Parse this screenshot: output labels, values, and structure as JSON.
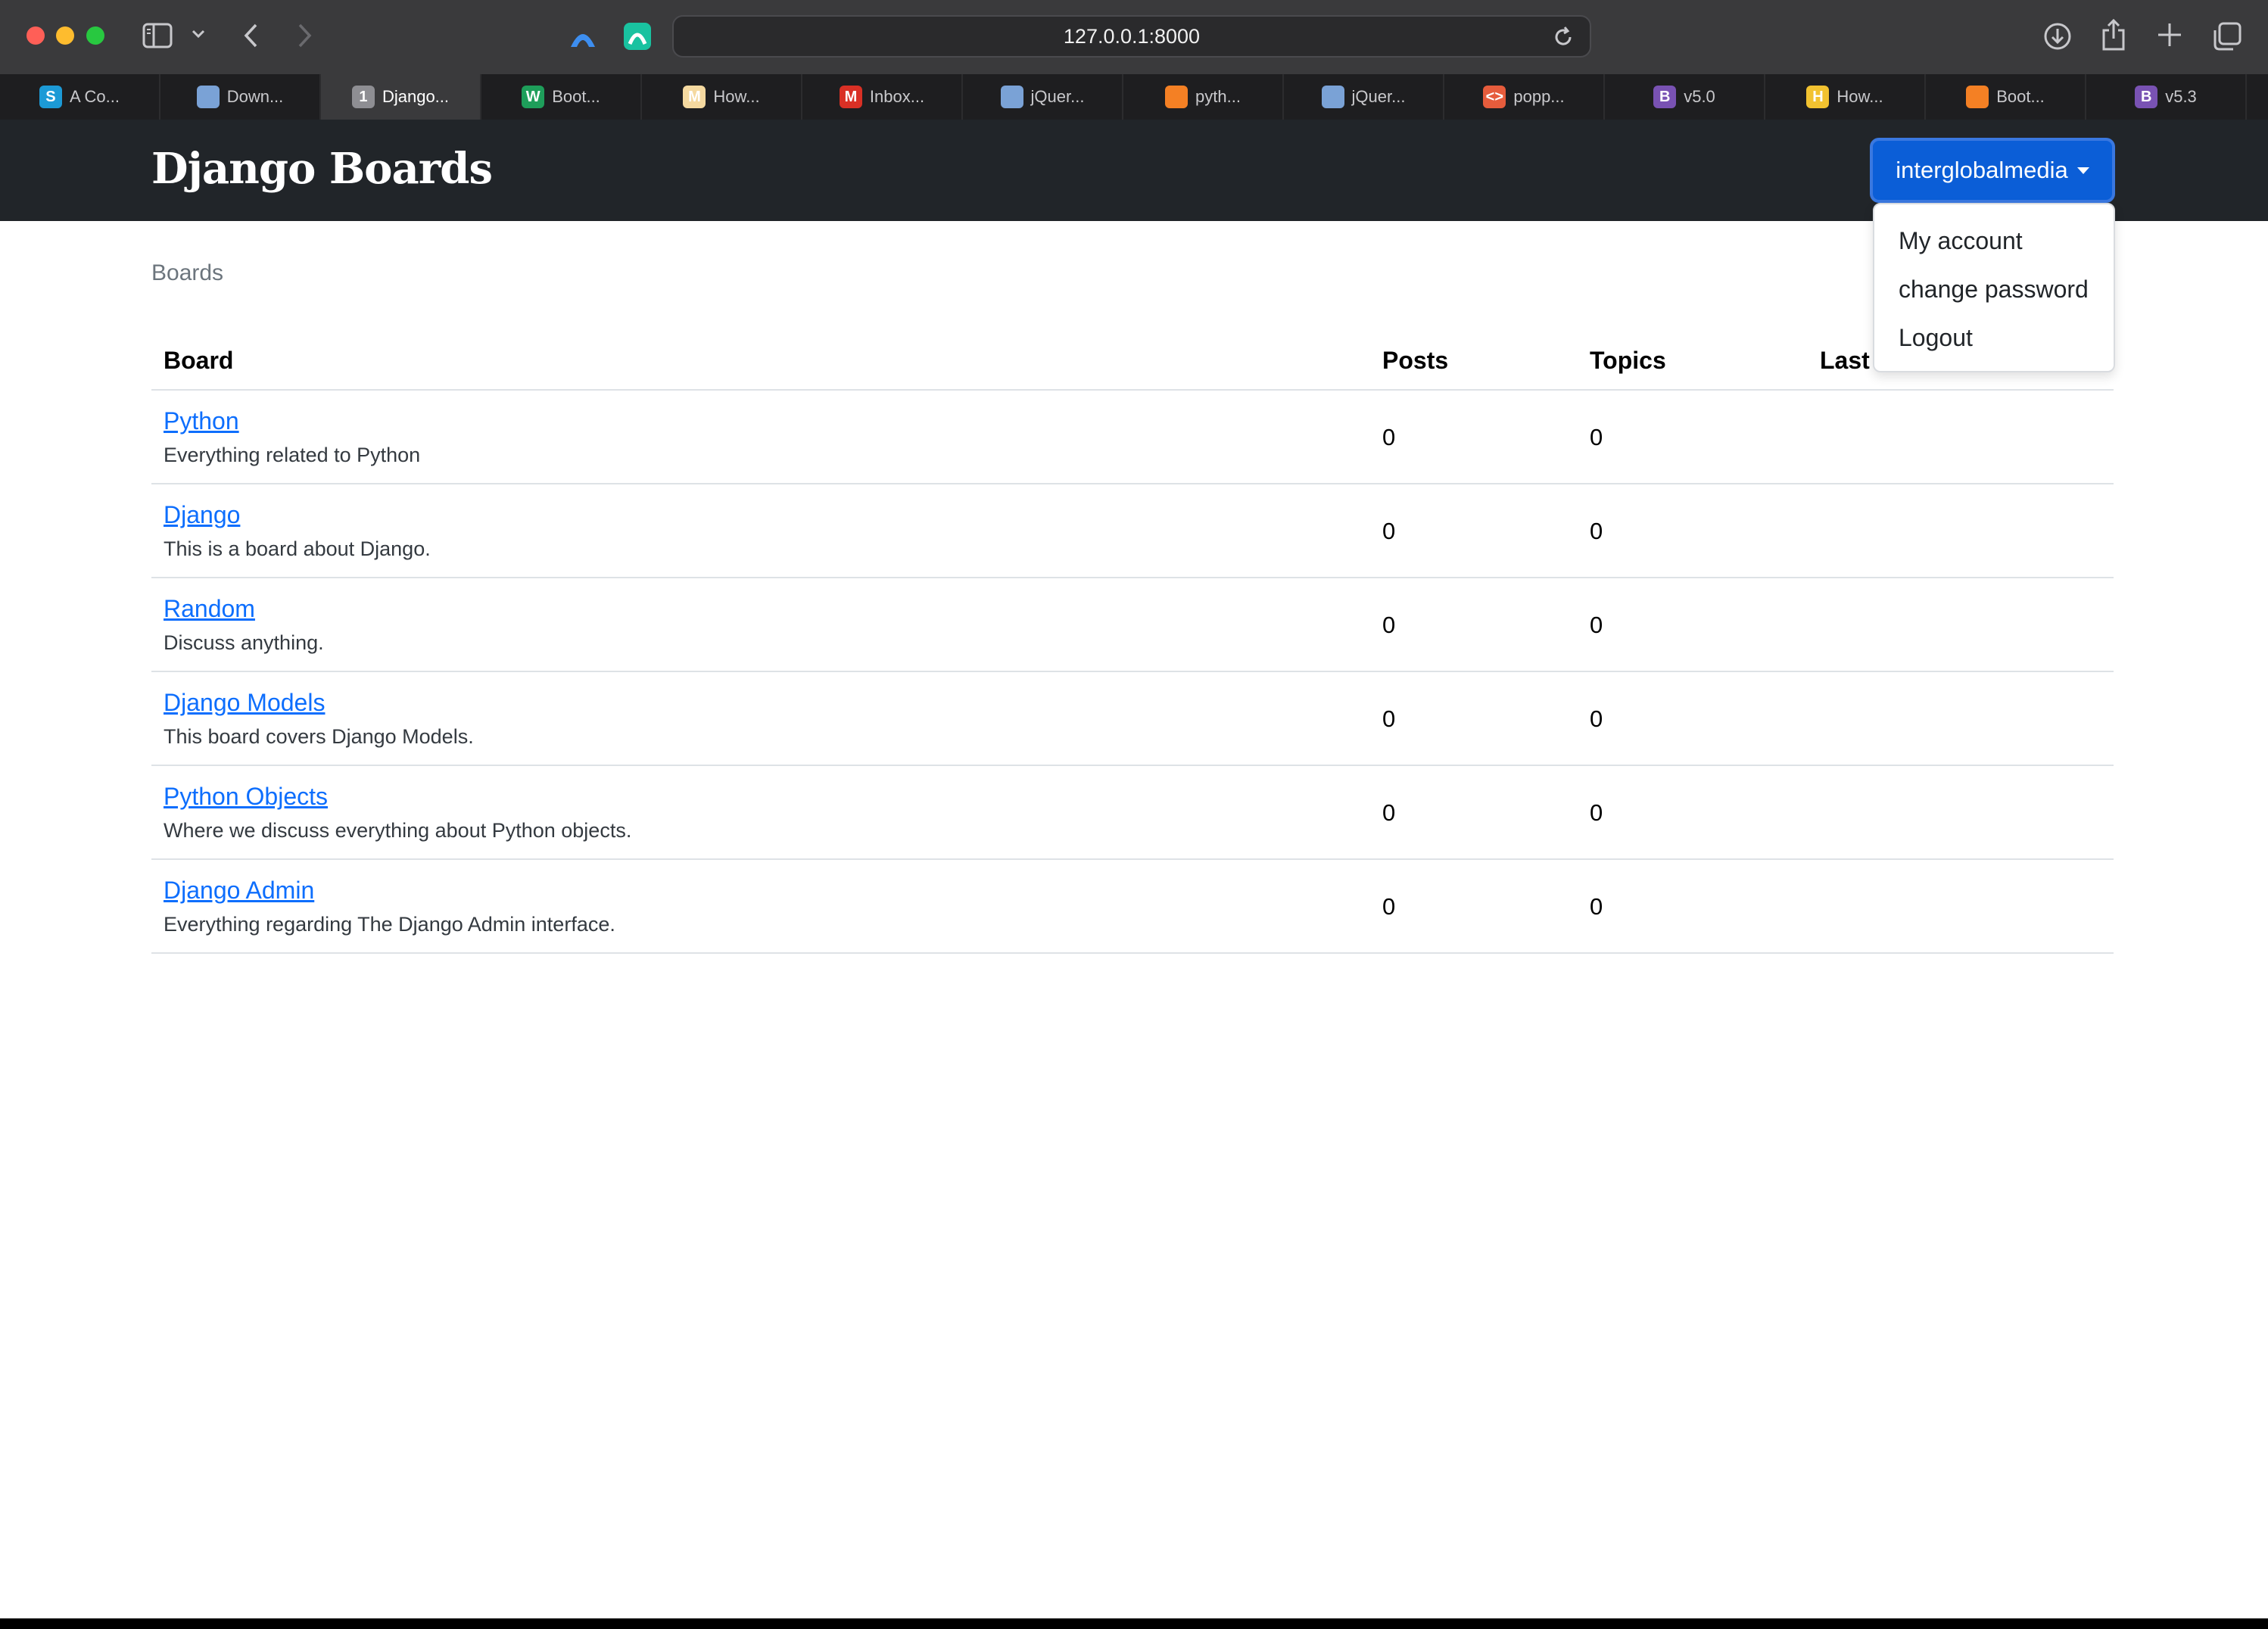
{
  "browser": {
    "url": "127.0.0.1:8000",
    "tabs": [
      {
        "icon": "s-favicon-icon",
        "letter": "S",
        "color": "#1c9ad6",
        "label": "A Co..."
      },
      {
        "icon": "jquery-favicon-icon",
        "letter": "",
        "color": "#7aa2d6",
        "label": "Down..."
      },
      {
        "icon": "number-favicon-icon",
        "letter": "1",
        "color": "#8e8e93",
        "label": "Django...",
        "active": true
      },
      {
        "icon": "w-favicon-icon",
        "letter": "W",
        "color": "#1e9e5a",
        "label": "Boot..."
      },
      {
        "icon": "m-favicon-icon",
        "letter": "M",
        "color": "#f5d9a0",
        "label": "How..."
      },
      {
        "icon": "gmail-favicon-icon",
        "letter": "M",
        "color": "#d93025",
        "label": "Inbox..."
      },
      {
        "icon": "jquery-favicon-icon",
        "letter": "",
        "color": "#7aa2d6",
        "label": "jQuer..."
      },
      {
        "icon": "stackoverflow-favicon-icon",
        "letter": "",
        "color": "#f48024",
        "label": "pyth..."
      },
      {
        "icon": "jquery-favicon-icon",
        "letter": "",
        "color": "#7aa2d6",
        "label": "jQuer..."
      },
      {
        "icon": "code-favicon-icon",
        "letter": "<>",
        "color": "#e65c3c",
        "label": "popp..."
      },
      {
        "icon": "bootstrap-favicon-icon",
        "letter": "B",
        "color": "#7952b3",
        "label": "v5.0"
      },
      {
        "icon": "h-favicon-icon",
        "letter": "H",
        "color": "#f2c230",
        "label": "How..."
      },
      {
        "icon": "stackoverflow-favicon-icon",
        "letter": "",
        "color": "#f48024",
        "label": "Boot..."
      },
      {
        "icon": "bootstrap-favicon-icon",
        "letter": "B",
        "color": "#7952b3",
        "label": "v5.3"
      }
    ]
  },
  "navbar": {
    "brand": "Django Boards",
    "user_button": "interglobalmedia",
    "dropdown": [
      "My account",
      "change password",
      "Logout"
    ]
  },
  "breadcrumb": "Boards",
  "table": {
    "headers": {
      "board": "Board",
      "posts": "Posts",
      "topics": "Topics",
      "last": "Last Post"
    },
    "rows": [
      {
        "name": "Python",
        "description": "Everything related to Python",
        "posts": "0",
        "topics": "0"
      },
      {
        "name": "Django",
        "description": "This is a board about Django.",
        "posts": "0",
        "topics": "0"
      },
      {
        "name": "Random",
        "description": "Discuss anything.",
        "posts": "0",
        "topics": "0"
      },
      {
        "name": "Django Models",
        "description": "This board covers Django Models.",
        "posts": "0",
        "topics": "0"
      },
      {
        "name": "Python Objects",
        "description": "Where we discuss everything about Python objects.",
        "posts": "0",
        "topics": "0"
      },
      {
        "name": "Django Admin",
        "description": "Everything regarding The Django Admin interface.",
        "posts": "0",
        "topics": "0"
      }
    ]
  },
  "colors": {
    "navbar": "#212529",
    "primary": "#0d6efd",
    "user_button": "#0b5ed7"
  }
}
